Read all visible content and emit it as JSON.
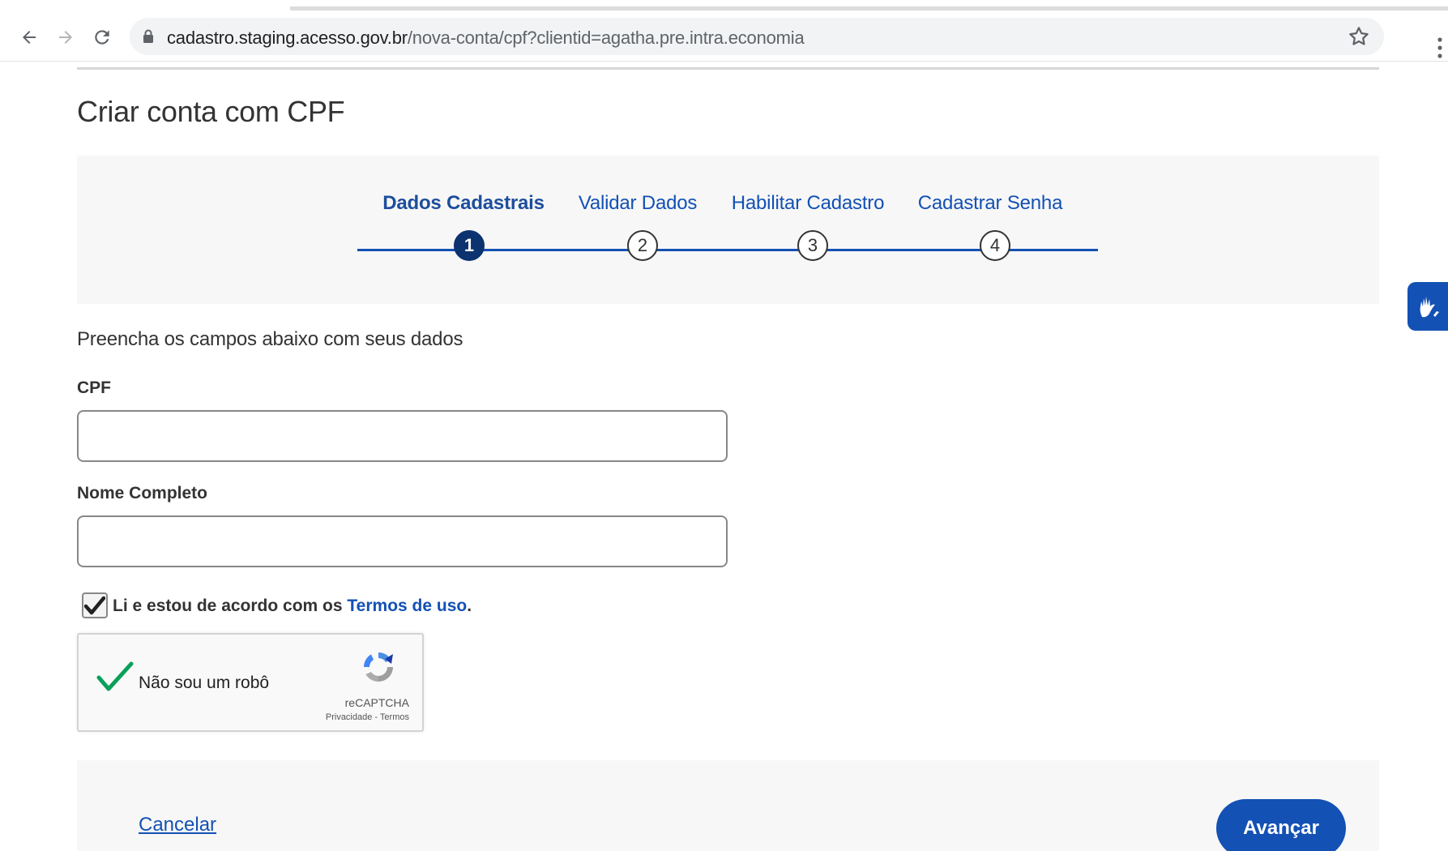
{
  "browser": {
    "url_host": "cadastro.staging.acesso.gov.br",
    "url_path": "/nova-conta/cpf?clientid=agatha.pre.intra.economia",
    "icons": [
      "back-arrow-icon",
      "forward-arrow-icon",
      "reload-icon",
      "lock-icon",
      "star-icon",
      "menu-dots-icon"
    ]
  },
  "page": {
    "title": "Criar conta com CPF",
    "instructions": "Preencha os campos abaixo com seus dados"
  },
  "stepper": {
    "steps": [
      {
        "label": "Dados Cadastrais",
        "number": "1",
        "active": true
      },
      {
        "label": "Validar Dados",
        "number": "2",
        "active": false
      },
      {
        "label": "Habilitar Cadastro",
        "number": "3",
        "active": false
      },
      {
        "label": "Cadastrar Senha",
        "number": "4",
        "active": false
      }
    ]
  },
  "form": {
    "cpf_label": "CPF",
    "cpf_value": "",
    "name_label": "Nome Completo",
    "name_value": "",
    "terms_checked": true,
    "terms_prefix": "Li e estou de acordo com os ",
    "terms_link": "Termos de uso",
    "terms_suffix": "."
  },
  "recaptcha": {
    "label": "Não sou um robô",
    "checked": true,
    "brand": "reCAPTCHA",
    "links": "Privacidade - Termos"
  },
  "footer": {
    "cancel_label": "Cancelar",
    "advance_label": "Avançar"
  },
  "colors": {
    "primary": "#1351b4",
    "active_step": "#0c326f",
    "panel_bg": "#f7f7f7",
    "check_green": "#0aa05a"
  }
}
